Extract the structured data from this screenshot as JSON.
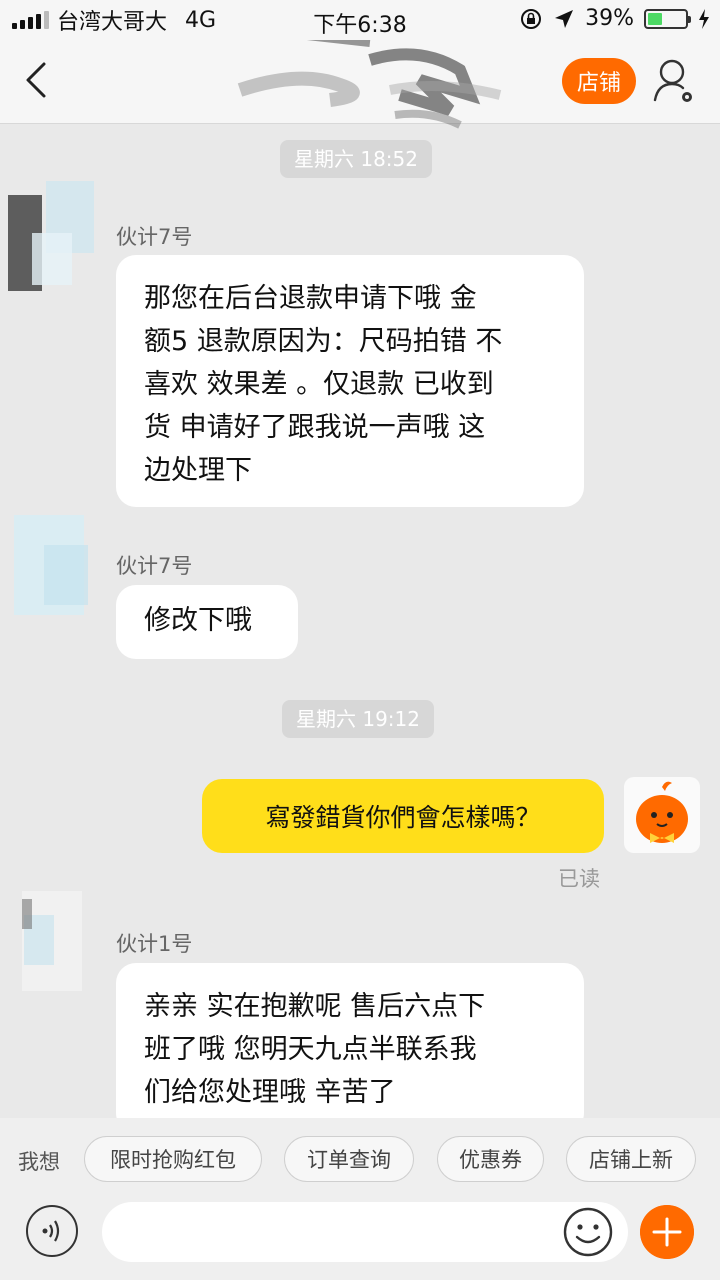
{
  "status_bar": {
    "carrier": "台湾大哥大",
    "network": "4G",
    "time": "下午6:38",
    "battery": "39%",
    "battery_level": 0.39
  },
  "nav": {
    "shop_label": "店铺"
  },
  "messages": {
    "time1": "星期六 18:52",
    "sender1": "伙计7号",
    "msg1_lines": [
      "那您在后台退款申请下哦 金",
      "额5 退款原因为：尺码拍错 不",
      "喜欢 效果差 。仅退款 已收到",
      "货 申请好了跟我说一声哦 这",
      "边处理下"
    ],
    "sender2": "伙计7号",
    "msg2": "修改下哦",
    "time2": "星期六 19:12",
    "my_msg": "寫發錯貨你們會怎樣嗎？",
    "read_status": "已读",
    "sender3": "伙计1号",
    "msg3_lines": [
      "亲亲 实在抱歉呢 售后六点下",
      "班了哦 您明天九点半联系我",
      "们给您处理哦 辛苦了"
    ]
  },
  "quick_replies": {
    "prefix": "我想",
    "chips": [
      "限时抢购红包",
      "订单查询",
      "优惠券",
      "店铺上新"
    ]
  },
  "colors": {
    "accent": "#ff6a00",
    "outgoing_bubble": "#ffde1a",
    "background": "#e9e9e9"
  },
  "icons": [
    "back-arrow-icon",
    "profile-settings-icon",
    "location-arrow-icon",
    "rotation-lock-icon",
    "voice-icon",
    "emoji-icon",
    "plus-icon"
  ]
}
